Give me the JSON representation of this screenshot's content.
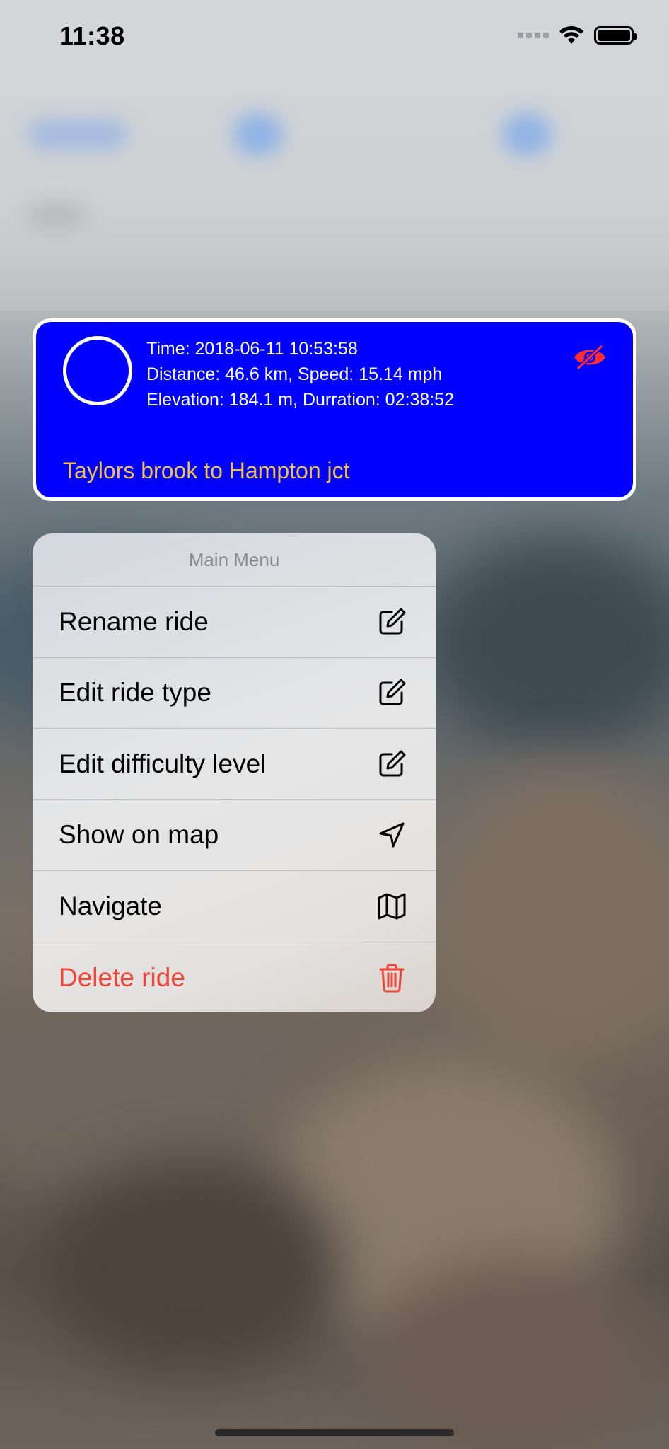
{
  "status_bar": {
    "time": "11:38"
  },
  "ride_card": {
    "time_line": "Time: 2018-06-11 10:53:58",
    "distance_line": "Distance: 46.6 km, Speed: 15.14 mph",
    "elevation_line": "Elevation: 184.1 m, Durration: 02:38:52",
    "title": "Taylors brook to Hampton jct",
    "background_color": "#0000ff",
    "title_color": "#f0c040",
    "hidden_icon": "eye-slash-icon",
    "hidden_icon_color": "#ff2d2d"
  },
  "menu": {
    "header": "Main Menu",
    "items": [
      {
        "label": "Rename ride",
        "icon": "square-pencil-icon"
      },
      {
        "label": "Edit ride type",
        "icon": "square-pencil-icon"
      },
      {
        "label": "Edit difficulty level",
        "icon": "square-pencil-icon"
      },
      {
        "label": "Show on map",
        "icon": "location-arrow-icon"
      },
      {
        "label": "Navigate",
        "icon": "map-icon"
      },
      {
        "label": "Delete ride",
        "icon": "trash-icon",
        "destructive": true,
        "color": "#f04438"
      }
    ]
  }
}
